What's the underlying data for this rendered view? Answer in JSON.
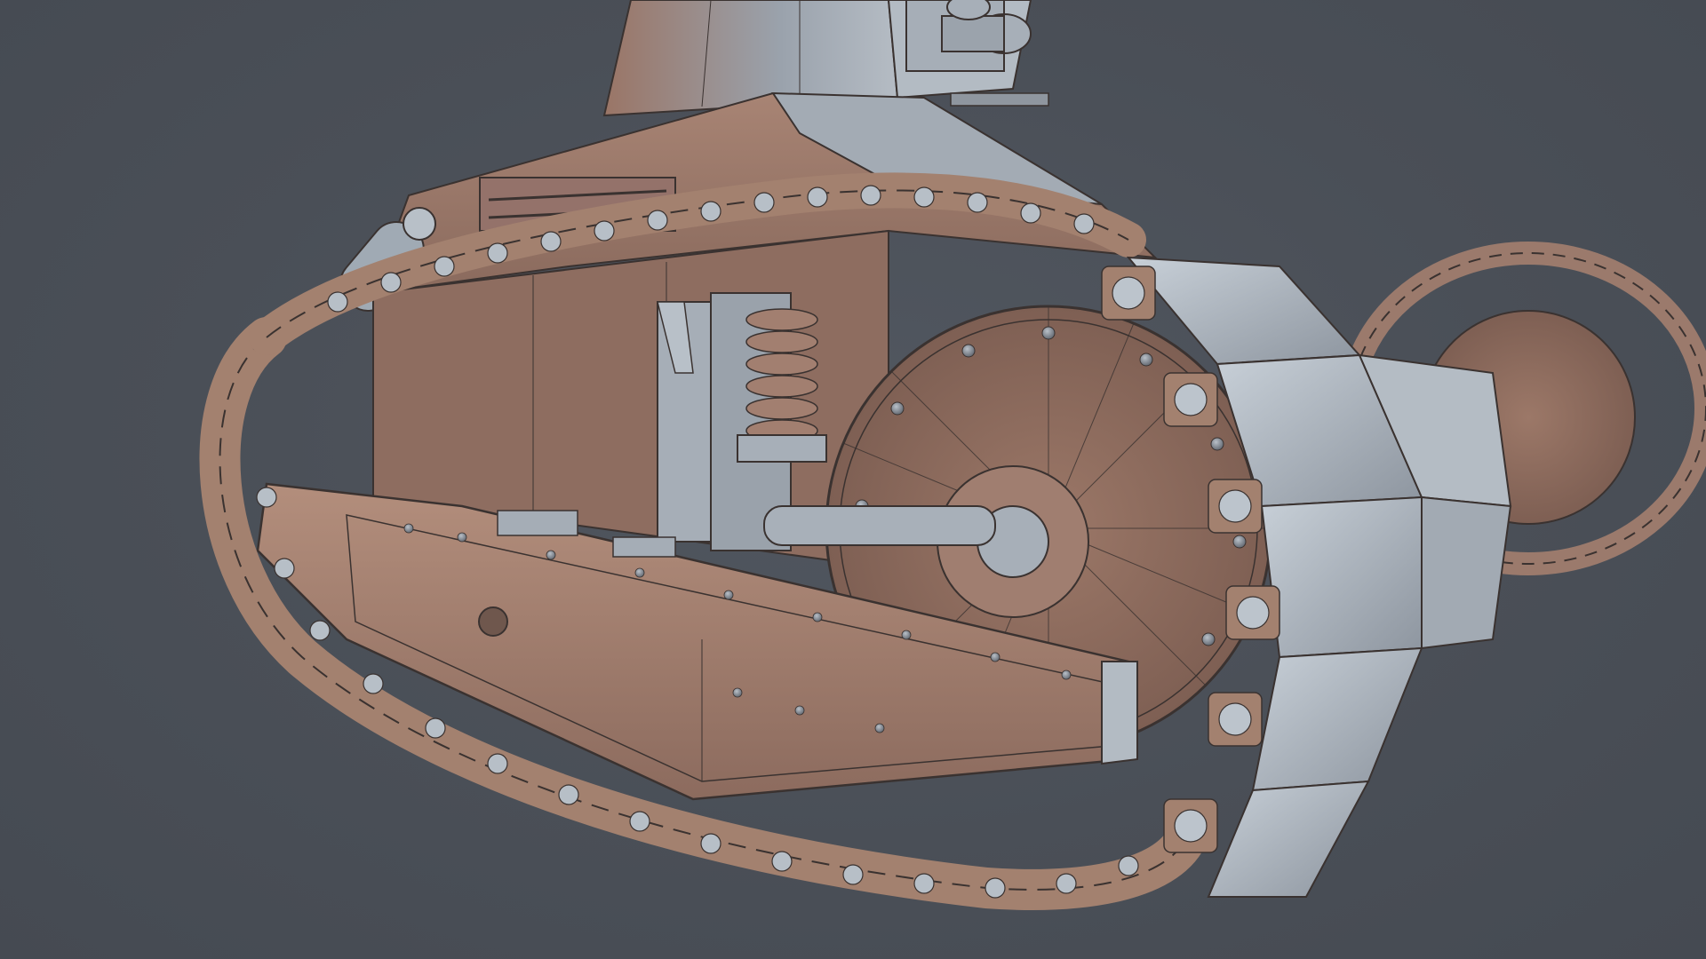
{
  "viewport": {
    "background_color": "#4a4f57",
    "subject": "tank-wireframe-render-icon"
  },
  "model": {
    "hull_color": "#a07a68",
    "hull_shadow_color": "#7d5e52",
    "track_plate_color": "#9aa3ad",
    "track_plate_light": "#c2cad2",
    "wire_color": "#3a3230",
    "wheel_color": "#8f6d5f"
  }
}
